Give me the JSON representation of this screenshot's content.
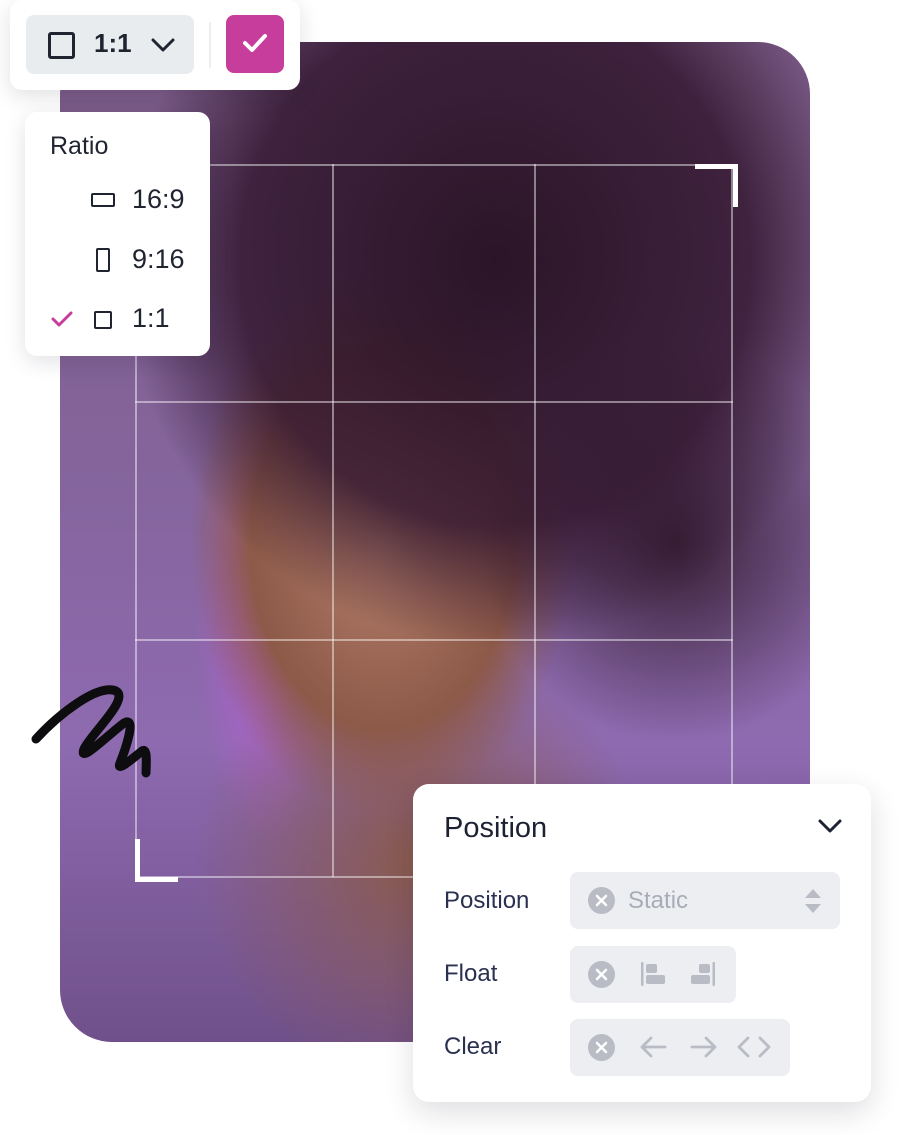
{
  "toolbar": {
    "ratio_value": "1:1"
  },
  "ratio_menu": {
    "title": "Ratio",
    "items": [
      {
        "label": "16:9",
        "selected": false
      },
      {
        "label": "9:16",
        "selected": false
      },
      {
        "label": "1:1",
        "selected": true
      }
    ]
  },
  "position_panel": {
    "title": "Position",
    "rows": {
      "position": {
        "label": "Position",
        "value": "Static"
      },
      "float": {
        "label": "Float"
      },
      "clear": {
        "label": "Clear"
      }
    }
  },
  "colors": {
    "accent": "#c73d9c",
    "control_bg": "#eceef1",
    "muted_text": "#a8acb6"
  },
  "icons": [
    "square-icon",
    "chevron-down-icon",
    "check-icon",
    "landscape-ratio-icon",
    "portrait-ratio-icon",
    "square-ratio-icon",
    "clear-x-icon",
    "up-down-arrows-icon",
    "float-left-icon",
    "float-right-icon",
    "arrow-left-icon",
    "arrow-right-icon",
    "code-both-icon"
  ]
}
